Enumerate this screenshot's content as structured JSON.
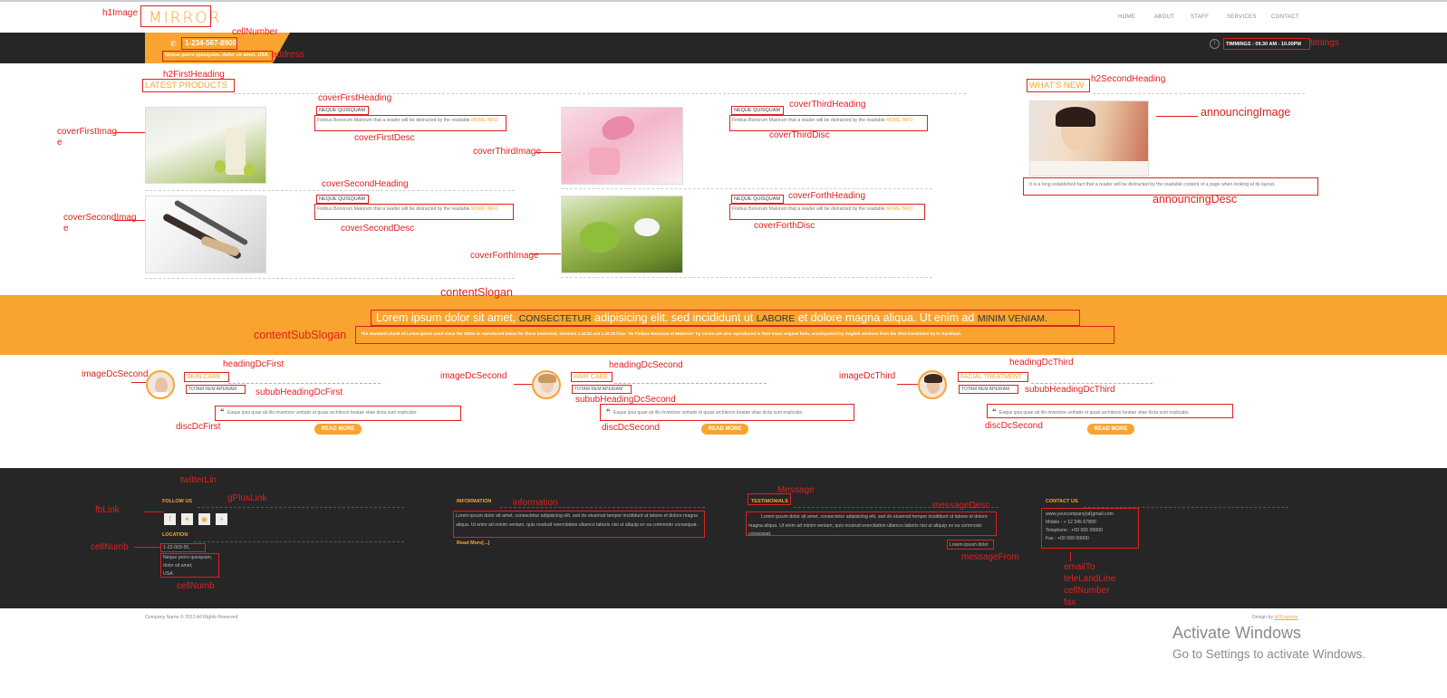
{
  "header": {
    "logo": "MIRROR",
    "nav": [
      "HOME",
      "ABOUT",
      "STAFF",
      "SERVICES",
      "CONTACT"
    ],
    "phone": "1-234-567-8900",
    "address": "Neque porro quisquam, dolor sit amet, USA",
    "timings": "TIMMINGS : 09.30 AM - 10.00PM"
  },
  "products": {
    "title": "LATEST PRODUCTS",
    "items": [
      {
        "heading": "NEQUE QUISQUAM",
        "desc": "Finibus Bonorum Malorum that a reader will be distracted by the readable",
        "more": "MORE INFO"
      },
      {
        "heading": "NEQUE QUISQUAM",
        "desc": "Finibus Bonorum Malorum that a reader will be distracted by the readable",
        "more": "MORE INFO"
      },
      {
        "heading": "NEQUE QUISQUAM",
        "desc": "Finibus Bonorum Malorum that a reader will be distracted by the readable",
        "more": "MORE INFO"
      },
      {
        "heading": "NEQUE QUISQUAM",
        "desc": "Finibus Bonorum Malorum that a reader will be distracted by the readable",
        "more": "MORE INFO"
      }
    ]
  },
  "whats_new": {
    "title": "WHAT'S NEW",
    "desc": "It is a long established fact that a reader will be distracted by the readable content of a page when looking at its layout."
  },
  "slogan": {
    "p1": "Lorem ipsum dolor sit amet,",
    "h1": "CONSECTETUR",
    "p2": "adipisicing elit. sed incididunt ut",
    "h2": "LABORE",
    "p3": "et dolore magna aliqua. Ut enim ad",
    "h3": "MINIM VENIAM.",
    "sub": "The standard chunk of Lorem Ipsum used since the 1500s is reproduced below for those interested. Sections 1.10.32 and 1.10.33 from \"de Finibus Bonorum et Malorum\" by Cicero are also reproduced in their exact original form, accompanied by English versions from the 1914 translation by H. Rackham."
  },
  "services": [
    {
      "heading": "SKIN CARE",
      "sub": "TOTAM REM APERIAM",
      "quote": "Eaque ipsa quae ab illo inventore veritatis et quasi architecto beatae vitae dicta sunt explicabo.",
      "button": "READ MORE"
    },
    {
      "heading": "HAIR CARE",
      "sub": "TOTAM REM APERIAM",
      "quote": "Eaque ipsa quae ab illo inventore veritatis et quasi architecto beatae vitae dicta sunt explicabo.",
      "button": "READ MORE"
    },
    {
      "heading": "FACIAL TREATMENT",
      "sub": "TOTAM REM APERIAM",
      "quote": "Eaque ipsa quae ab illo inventore veritatis et quasi architecto beatae vitae dicta sunt explicabo.",
      "button": "READ MORE"
    }
  ],
  "footer": {
    "follow_title": "FOLLOW US",
    "location_title": "LOCATION",
    "location_phone": "1-22-003-55,",
    "location_addr1": "Neque porro quisquam,",
    "location_addr2": "dolor sit amet,",
    "location_addr3": "USA.",
    "info_title": "INFORMATION",
    "info_text": "Lorem ipsum dolor sit amet, consectetur adipisicing elit, sed do eiusmod tempor incididunt ut labore et dolore magna aliqua. Ut enim ad minim veniam, quis nostrud exercitation ullamco laboris nisi ut aliquip ex ea commodo consequat.",
    "info_more": "Read More[...]",
    "test_title": "TESTIMONIALS",
    "test_text": "Lorem ipsum dolor sit amet, consectetur adipisicing elit, sed do eiusmod tempor incididunt ut labore et dolore magna aliqua. Ut enim ad minim veniam, quis nostrud exercitation ullamco laboris nisi ut aliquip ex ea commodo consequat.",
    "test_from": "Lorem ipsum dolor",
    "contact_title": "CONTACT US",
    "email": "www.yourcompany(at)gmail.com",
    "mobile": "Mobile : + 12 345 67890",
    "telephone": "Telephone : +00 000 00000",
    "fax": "Fax : +00 000 00000"
  },
  "bottom": {
    "copyright": "Company Name © 2013 All Rights Reserved",
    "design_by": "Design by",
    "design_link": "W3Layouts"
  },
  "watermark": {
    "title": "Activate Windows",
    "sub": "Go to Settings to activate Windows."
  },
  "annotations": {
    "h1Image": "h1Image",
    "cellNumber": "cellNumber",
    "address": "address",
    "timings": "timings",
    "h2FirstHeading": "h2FirstHeading",
    "h2SecondHeading": "h2SecondHeading",
    "coverFirstHeading": "coverFirstHeading",
    "coverFirstDesc": "coverFirstDesc",
    "coverFirstImage_1": "coverFirstImag",
    "coverFirstImage_2": "e",
    "coverSecondHeading": "coverSecondHeading",
    "coverSecondDesc": "coverSecondDesc",
    "coverSecondImage_1": "coverSecondImag",
    "coverSecondImage_2": "e",
    "coverThirdHeading": "coverThirdHeading",
    "coverThirdDisc": "coverThirdDisc",
    "coverThirdImage": "coverThirdImage",
    "coverForthHeading": "coverForthHeading",
    "coverForthDisc": "coverForthDisc",
    "coverForthImage": "coverForthImage",
    "announcingImage": "announcingImage",
    "announcingDesc": "announcingDesc",
    "contentSlogan": "contentSlogan",
    "contentSubSlogan": "contentSubSlogan",
    "imageDcSecond_a": "imageDcSecond",
    "imageDcSecond_b": "imageDcSecond",
    "imageDcThird": "imageDcThird",
    "headingDcFirst": "headingDcFirst",
    "headingDcSecond": "headingDcSecond",
    "headingDcThird": "headingDcThird",
    "sububHeadingDcFirst": "sububHeadingDcFirst",
    "sububHeadingDcSecond": "sububHeadingDcSecond",
    "sububHeadingDcThird": "sububHeadingDcThird",
    "discDcFirst": "discDcFirst",
    "discDcSecond_a": "discDcSecond",
    "discDcSecond_b": "discDcSecond",
    "twitterLin": "twitterLin",
    "gPlusLink": "gPlusLink",
    "fbLink": "fbLink",
    "cellNumb_a": "cellNumb",
    "cellNumb_b": "cellNumb",
    "information": "information",
    "message": "Message",
    "messageDesc": "messageDesc",
    "messageFrom": "messageFrom",
    "emailTo": "emailTo",
    "teleLandLine": "teleLandLine",
    "cellNumberFax": "cellNumber",
    "fax": "fax"
  }
}
